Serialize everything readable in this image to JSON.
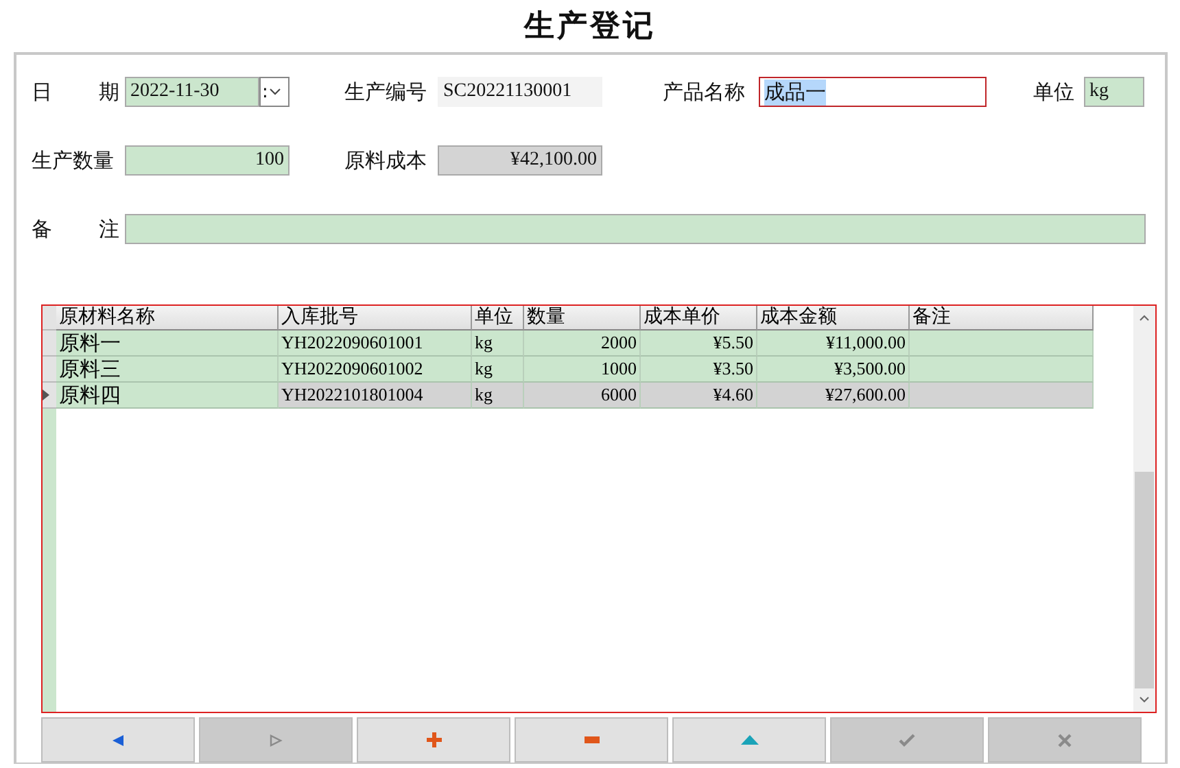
{
  "title": "生产登记",
  "form": {
    "date_label": "日 期",
    "date": "2022-11-30",
    "spin": ":",
    "code_label": "生产编号",
    "code": "SC20221130001",
    "product_label": "产品名称",
    "product": "成品一",
    "unit_label": "单位",
    "unit": "kg",
    "qty_label": "生产数量",
    "qty": "100",
    "cost_label": "原料成本",
    "cost": "¥42,100.00",
    "note_label": "备 注"
  },
  "table": {
    "columns": [
      "原材料名称",
      "入库批号",
      "单位",
      "数量",
      "成本单价",
      "成本金额",
      "备注"
    ],
    "rows": [
      {
        "cells": [
          "原料一",
          "YH2022090601001",
          "kg",
          "2000",
          "¥5.50",
          "¥11,000.00",
          ""
        ],
        "selected": false
      },
      {
        "cells": [
          "原料三",
          "YH2022090601002",
          "kg",
          "1000",
          "¥3.50",
          "¥3,500.00",
          ""
        ],
        "selected": false
      },
      {
        "cells": [
          "原料四",
          "YH2022101801004",
          "kg",
          "6000",
          "¥4.60",
          "¥27,600.00",
          ""
        ],
        "selected": true
      }
    ]
  },
  "buttons": [
    {
      "kind": "prev",
      "disabled": false
    },
    {
      "kind": "next",
      "disabled": true
    },
    {
      "kind": "add",
      "disabled": false
    },
    {
      "kind": "remove",
      "disabled": false
    },
    {
      "kind": "up",
      "disabled": false
    },
    {
      "kind": "confirm",
      "disabled": true
    },
    {
      "kind": "cancel",
      "disabled": true
    }
  ]
}
